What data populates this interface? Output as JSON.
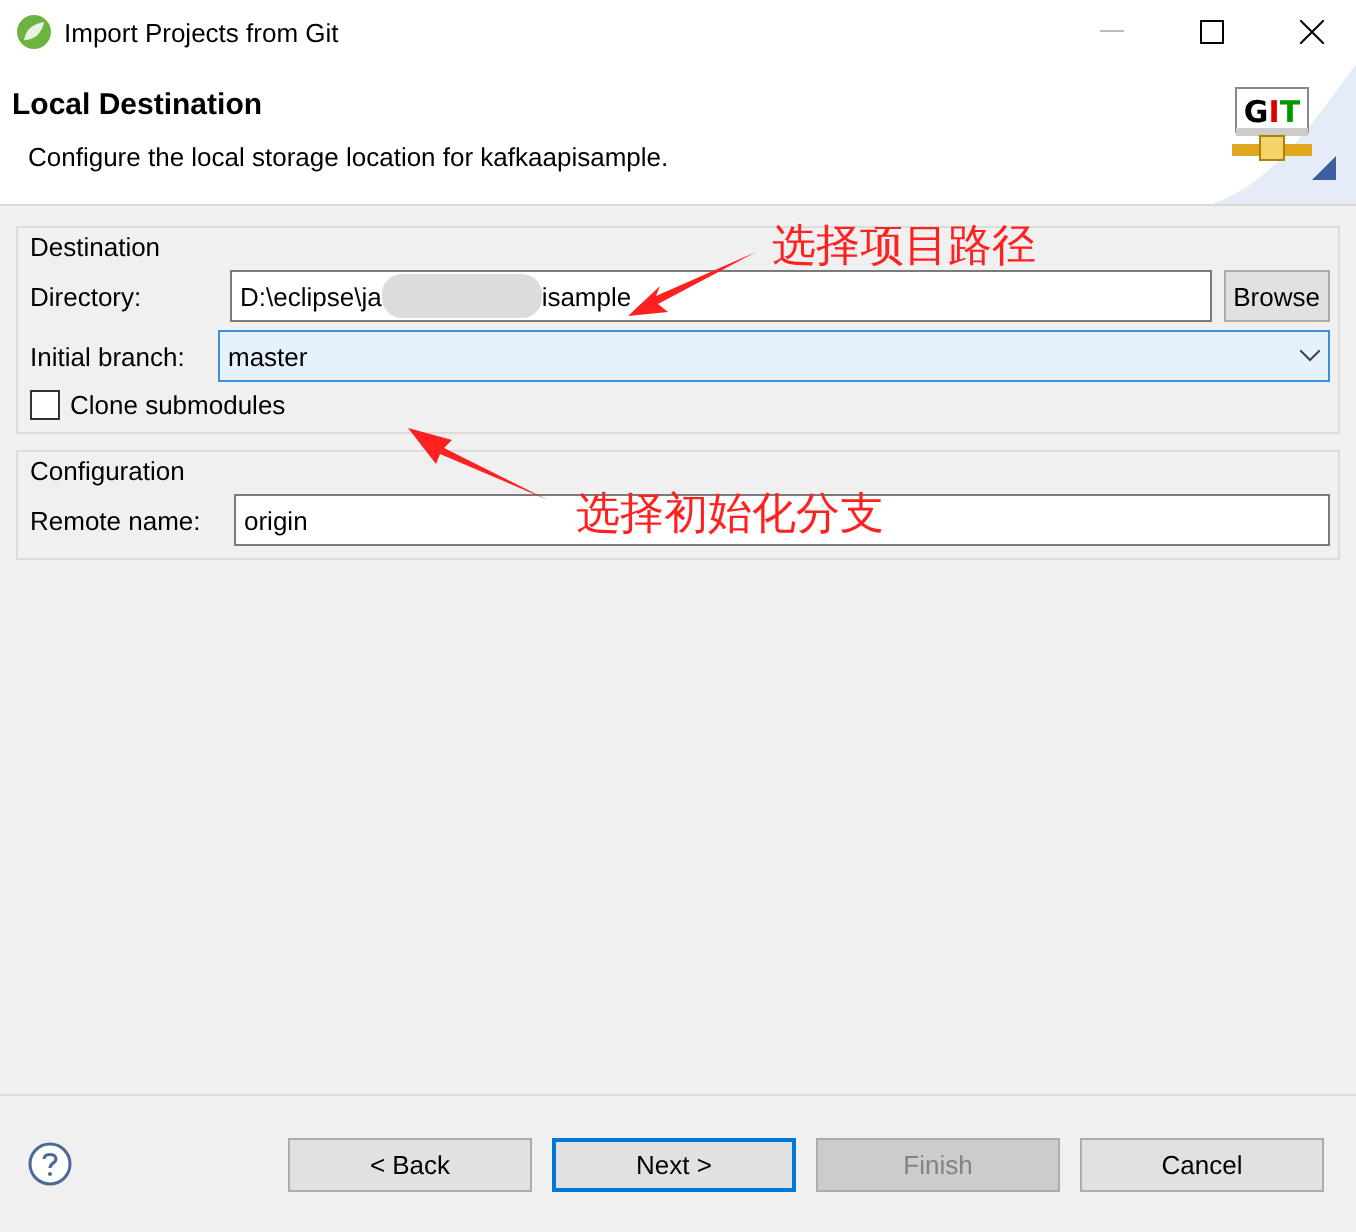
{
  "window": {
    "title": "Import Projects from Git"
  },
  "logo": {
    "letters": [
      "G",
      "I",
      "T"
    ]
  },
  "header": {
    "title": "Local Destination",
    "description": "Configure the local storage location for kafkaapisample."
  },
  "destination": {
    "legend": "Destination",
    "directory": {
      "label": "Directory:",
      "value_start": "D:\\eclipse\\ja",
      "value_end": "isample",
      "blurred": true,
      "button": "Browse"
    },
    "branch": {
      "label": "Initial branch:",
      "value": "master",
      "focused": true
    },
    "clone": {
      "label": "Clone submodules",
      "checked": false
    }
  },
  "configuration": {
    "legend": "Configuration",
    "remote": {
      "label": "Remote name:",
      "value": "origin"
    }
  },
  "buttons": [
    {
      "label": "< Back",
      "disabled": false,
      "default": false
    },
    {
      "label": "Next >",
      "disabled": false,
      "default": true
    },
    {
      "label": "Finish",
      "disabled": true,
      "default": false
    },
    {
      "label": "Cancel",
      "disabled": false,
      "default": false
    }
  ],
  "annotations": [
    {
      "text": "选择项目路径"
    },
    {
      "text": "选择初始化分支"
    }
  ]
}
